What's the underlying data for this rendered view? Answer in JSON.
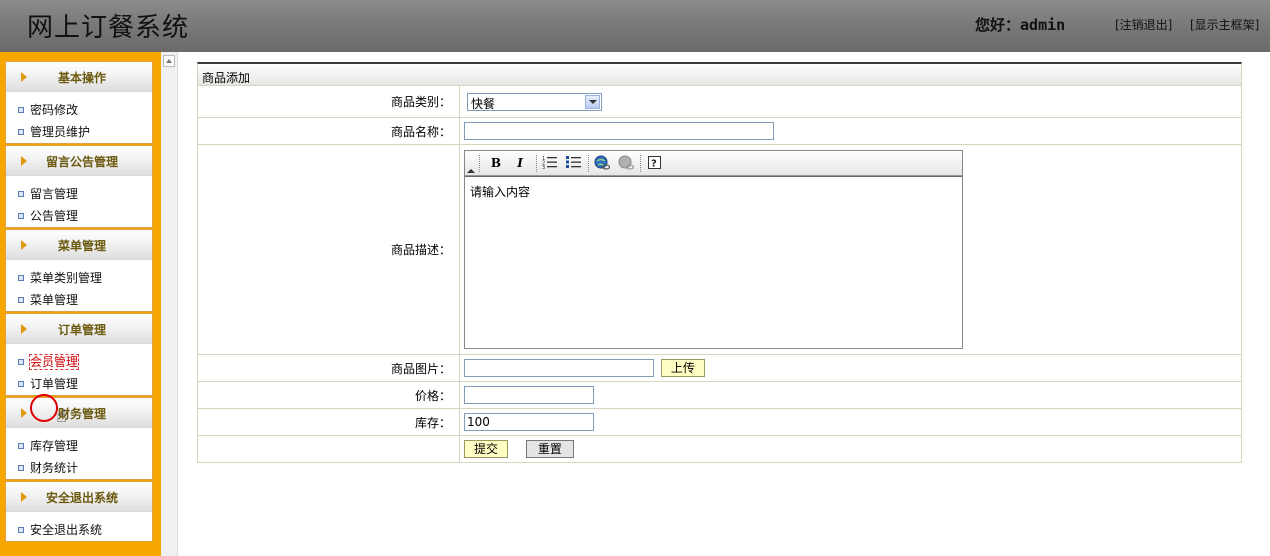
{
  "header": {
    "title": "网上订餐系统",
    "greeting_prefix": "您好：",
    "username": "admin",
    "logout_link": "[注销退出]",
    "frame_link": "[显示主框架]"
  },
  "sidebar": {
    "panels": [
      {
        "title": "基本操作",
        "items": [
          "密码修改",
          "管理员维护"
        ]
      },
      {
        "title": "留言公告管理",
        "items": [
          "留言管理",
          "公告管理"
        ]
      },
      {
        "title": "菜单管理",
        "items": [
          "菜单类别管理",
          "菜单管理"
        ]
      },
      {
        "title": "订单管理",
        "items": [
          "会员管理",
          "订单管理"
        ]
      },
      {
        "title": "财务管理",
        "items": [
          "库存管理",
          "财务统计"
        ]
      },
      {
        "title": "安全退出系统",
        "items": [
          "安全退出系统"
        ]
      }
    ],
    "active_item": "会员管理"
  },
  "form": {
    "heading": "商品添加",
    "category_label": "商品类别：",
    "category_value": "快餐",
    "name_label": "商品名称：",
    "name_value": "",
    "desc_label": "商品描述：",
    "desc_placeholder": "请输入内容",
    "image_label": "商品图片：",
    "image_value": "",
    "upload_button": "上传",
    "price_label": "价格：",
    "price_value": "",
    "stock_label": "库存：",
    "stock_value": "100",
    "submit_button": "提交",
    "reset_button": "重置"
  },
  "editor_toolbar": {
    "bold": "B",
    "italic": "I",
    "icons": [
      "ordered-list-icon",
      "unordered-list-icon",
      "insert-link-icon",
      "remove-link-icon",
      "help-icon"
    ]
  },
  "colors": {
    "sidebar_bg": "#f7a600",
    "header_bg": "#7a7a7a",
    "highlight_button": "#ffffc4"
  }
}
